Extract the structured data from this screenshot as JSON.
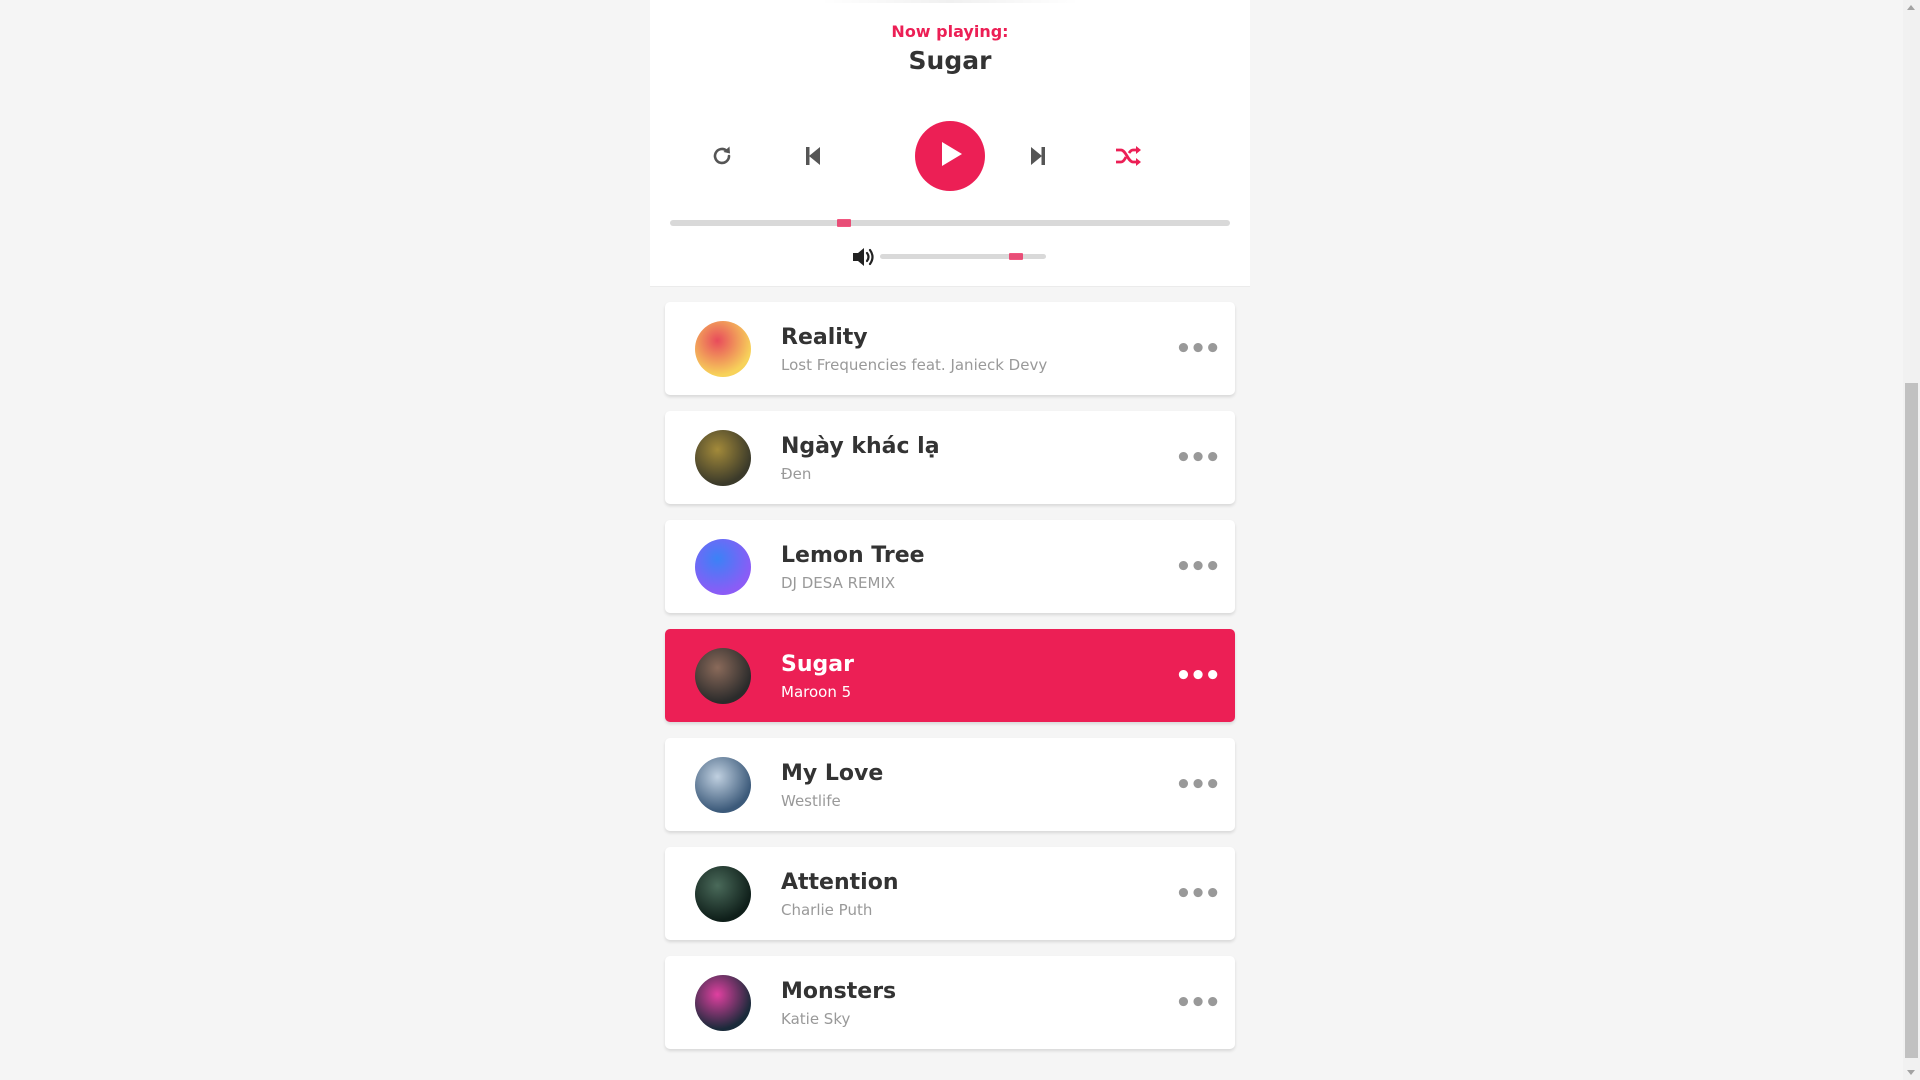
{
  "player": {
    "now_playing_label": "Now playing:",
    "current_title": "Sugar",
    "progress_fraction": 0.31,
    "volume_fraction": 0.82,
    "accent_color": "#ec1f55",
    "icons": {
      "repeat": "repeat-icon",
      "prev": "skip-back-icon",
      "play": "play-icon",
      "next": "skip-forward-icon",
      "shuffle": "shuffle-icon",
      "volume": "volume-icon"
    }
  },
  "playlist": [
    {
      "title": "Reality",
      "singer": "Lost Frequencies feat. Janieck Devy",
      "active": false,
      "art": [
        "#f7d25a",
        "#e84b5b"
      ]
    },
    {
      "title": "Ngày khác lạ",
      "singer": "Đen",
      "active": false,
      "art": [
        "#3b3a2a",
        "#a38a3a"
      ]
    },
    {
      "title": "Lemon Tree",
      "singer": "DJ DESA REMIX",
      "active": false,
      "art": [
        "#8b5cf6",
        "#3b82f6"
      ]
    },
    {
      "title": "Sugar",
      "singer": "Maroon 5",
      "active": true,
      "art": [
        "#2b2b2b",
        "#8a6a5a"
      ]
    },
    {
      "title": "My Love",
      "singer": "Westlife",
      "active": false,
      "art": [
        "#3c5a7a",
        "#c0d0e0"
      ]
    },
    {
      "title": "Attention",
      "singer": "Charlie Puth",
      "active": false,
      "art": [
        "#0f1f1a",
        "#4a6a5a"
      ]
    },
    {
      "title": "Monsters",
      "singer": "Katie Sky",
      "active": false,
      "art": [
        "#1a2a3a",
        "#e040a0"
      ]
    }
  ],
  "more_options_glyph": "•••"
}
